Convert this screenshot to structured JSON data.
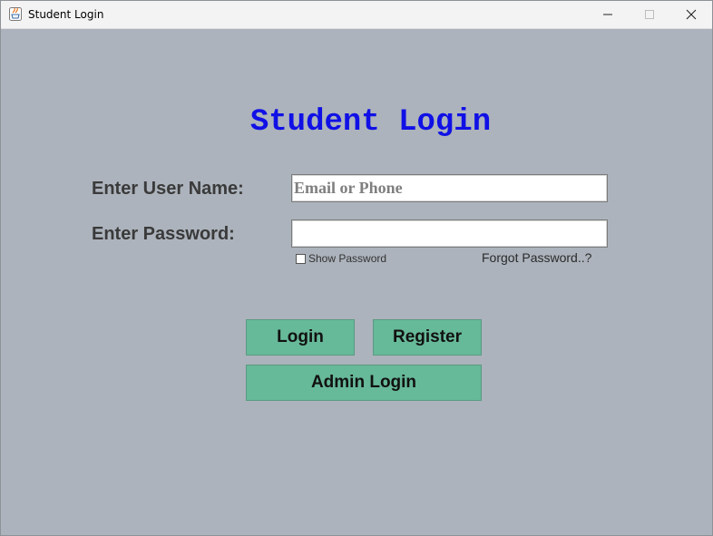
{
  "window": {
    "title": "Student Login",
    "icon": "java-cup-icon",
    "controls": [
      "minimize-icon",
      "maximize-icon",
      "close-icon"
    ]
  },
  "form": {
    "heading": "Student Login",
    "username_label": "Enter User Name:",
    "username_placeholder": "Email or Phone",
    "username_value": "",
    "password_label": "Enter Password:",
    "password_value": "",
    "show_password_label": "Show Password",
    "show_password_checked": false,
    "forgot_password_label": "Forgot Password..?"
  },
  "buttons": {
    "login": "Login",
    "register": "Register",
    "admin_login": "Admin Login"
  },
  "colors": {
    "background": "#acb3bc",
    "heading": "#1010e6",
    "button": "#66b999"
  }
}
